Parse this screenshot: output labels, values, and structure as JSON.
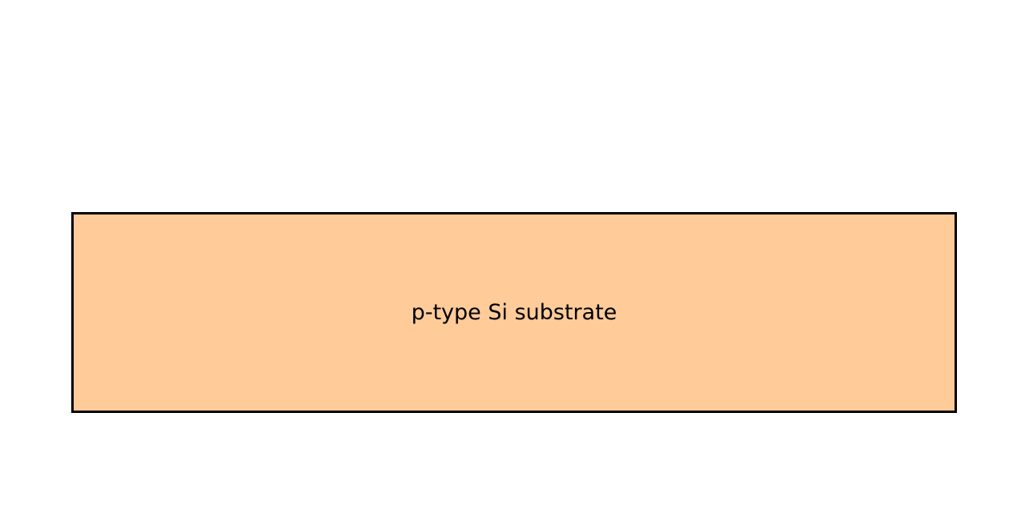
{
  "diagram": {
    "layers": [
      {
        "label": "p-type Si substrate",
        "fill_color": "#FECB99",
        "stroke_color": "#000000"
      }
    ]
  }
}
